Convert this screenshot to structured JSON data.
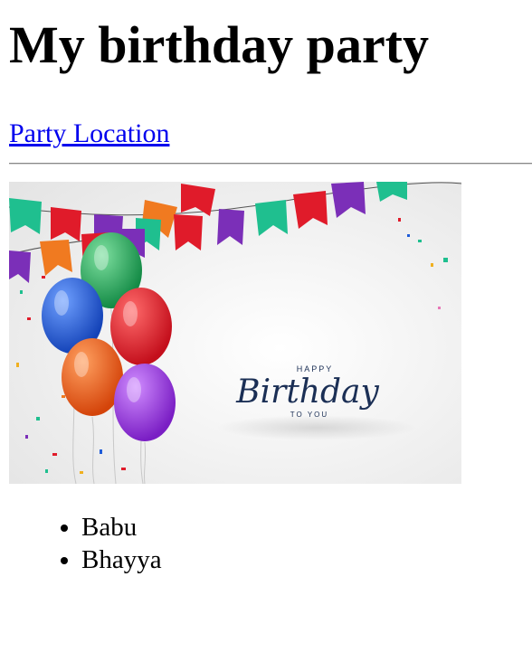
{
  "page": {
    "title": "My birthday party",
    "link_text": "Party Location"
  },
  "banner": {
    "happy": "HAPPY",
    "script": "Birthday",
    "to_you": "TO YOU"
  },
  "guests": [
    "Babu",
    "Bhayya"
  ],
  "colors": {
    "link": "#0000ee",
    "balloon_blue": "#1e5bd8",
    "balloon_green": "#1fae5a",
    "balloon_red": "#e01b2a",
    "balloon_orange": "#ee5a15",
    "balloon_purple": "#9b2fe0",
    "text_navy": "#1b2f55"
  }
}
